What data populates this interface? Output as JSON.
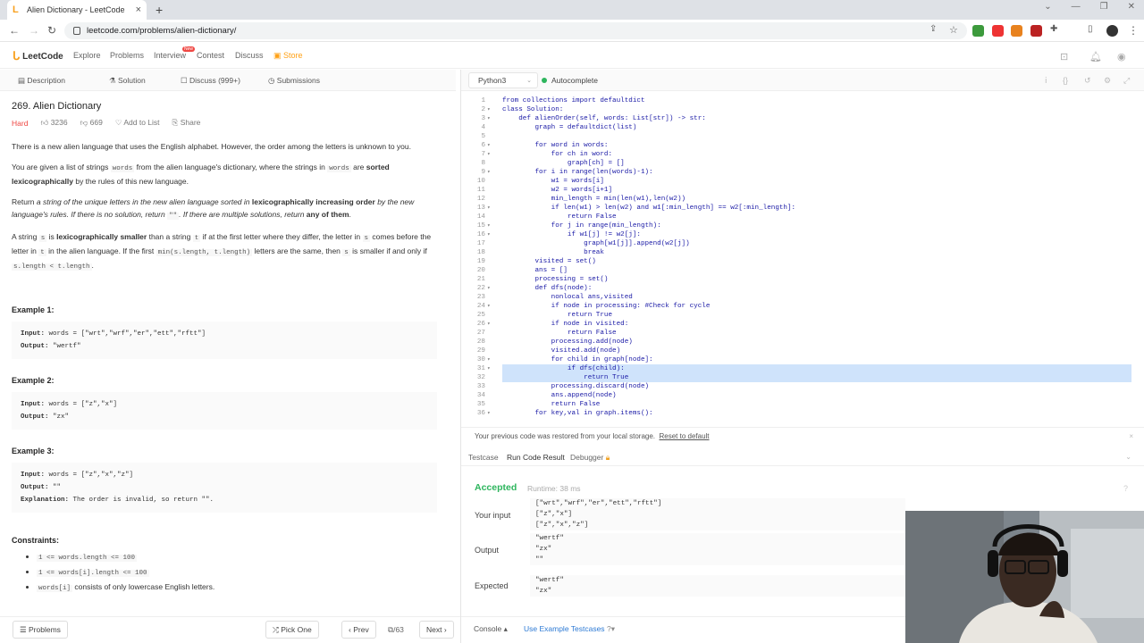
{
  "browser": {
    "tab_title": "Alien Dictionary - LeetCode",
    "url": "leetcode.com/problems/alien-dictionary/"
  },
  "header": {
    "logo_text": "LeetCode",
    "nav": [
      "Explore",
      "Problems",
      "Interview",
      "Contest",
      "Discuss",
      "Store"
    ],
    "new_badge": "New"
  },
  "left_tabs": [
    "Description",
    "Solution",
    "Discuss (999+)",
    "Submissions"
  ],
  "problem": {
    "title": "269. Alien Dictionary",
    "difficulty": "Hard",
    "likes": "3236",
    "dislikes": "669",
    "add_to_list": "Add to List",
    "share": "Share",
    "p1": "There is a new alien language that uses the English alphabet. However, the order among the letters is unknown to you.",
    "p2a": "You are given a list of strings ",
    "p2_code1": "words",
    "p2b": " from the alien language's dictionary, where the strings in ",
    "p2_code2": "words",
    "p2c": " are ",
    "p2_bold": "sorted lexicographically",
    "p2d": " by the rules of this new language.",
    "p3a": "Return ",
    "p3_i1": "a string of the unique letters in the new alien language sorted in ",
    "p3_bold": "lexicographically increasing order",
    "p3_i2": " by the new language's rules. If there is no solution, return ",
    "p3_code": "\"\"",
    "p3_i3": ". If there are multiple solutions, return ",
    "p3_bold2": "any of them",
    "p3_end": ".",
    "p4a": "A string ",
    "p4_s": "s",
    "p4b": " is ",
    "p4_bold": "lexicographically smaller",
    "p4c": " than a string ",
    "p4_t": "t",
    "p4d": " if at the first letter where they differ, the letter in ",
    "p4_s2": "s",
    "p4e": " comes before the letter in ",
    "p4_t2": "t",
    "p4f": " in the alien language. If the first ",
    "p4_code_min": "min(s.length, t.length)",
    "p4g": " letters are the same, then ",
    "p4_s3": "s",
    "p4h": " is smaller if and only if ",
    "p4_code_len": "s.length < t.length",
    "p4i": ".",
    "examples": [
      {
        "heading": "Example 1:",
        "input_label": "Input:",
        "input": "words = [\"wrt\",\"wrf\",\"er\",\"ett\",\"rftt\"]",
        "output_label": "Output:",
        "output": "\"wertf\""
      },
      {
        "heading": "Example 2:",
        "input_label": "Input:",
        "input": "words = [\"z\",\"x\"]",
        "output_label": "Output:",
        "output": "\"zx\""
      },
      {
        "heading": "Example 3:",
        "input_label": "Input:",
        "input": "words = [\"z\",\"x\",\"z\"]",
        "output_label": "Output:",
        "output": "\"\"",
        "explanation_label": "Explanation:",
        "explanation": "The order is invalid, so return \"\"."
      }
    ],
    "constraints_heading": "Constraints:",
    "constraints": [
      "1 <= words.length <= 100",
      "1 <= words[i].length <= 100"
    ],
    "constraint3_code": "words[i]",
    "constraint3_text": " consists of only lowercase English letters."
  },
  "left_footer": {
    "problems": "Problems",
    "pick_one": "Pick One",
    "prev": "Prev",
    "page": "/63",
    "next": "Next"
  },
  "editor_toolbar": {
    "language": "Python3",
    "autocomplete": "Autocomplete"
  },
  "code_lines": [
    "from collections import defaultdict",
    "class Solution:",
    "    def alienOrder(self, words: List[str]) -> str:",
    "        graph = defaultdict(list)",
    "",
    "        for word in words:",
    "            for ch in word:",
    "                graph[ch] = []",
    "        for i in range(len(words)-1):",
    "            w1 = words[i]",
    "            w2 = words[i+1]",
    "            min_length = min(len(w1),len(w2))",
    "            if len(w1) > len(w2) and w1[:min_length] == w2[:min_length]:",
    "                return False",
    "            for j in range(min_length):",
    "                if w1[j] != w2[j]:",
    "                    graph[w1[j]].append(w2[j])",
    "                    break",
    "        visited = set()",
    "        ans = []",
    "        processing = set()",
    "        def dfs(node):",
    "            nonlocal ans,visited",
    "            if node in processing: #Check for cycle",
    "                return True",
    "            if node in visited:",
    "                return False",
    "            processing.add(node)",
    "            visited.add(node)",
    "            for child in graph[node]:",
    "                if dfs(child):",
    "                    return True",
    "            processing.discard(node)",
    "            ans.append(node)",
    "            return False",
    "        for key,val in graph.items():"
  ],
  "console": {
    "restored_msg": "Your previous code was restored from your local storage.",
    "reset_link": "Reset to default",
    "tabs": [
      "Testcase",
      "Run Code Result",
      "Debugger"
    ],
    "status": "Accepted",
    "runtime": "Runtime: 38 ms",
    "your_input_label": "Your input",
    "your_input": [
      "[\"wrt\",\"wrf\",\"er\",\"ett\",\"rftt\"]",
      "[\"z\",\"x\"]",
      "[\"z\",\"x\",\"z\"]"
    ],
    "output_label": "Output",
    "output": [
      "\"wertf\"",
      "\"zx\"",
      "\"\""
    ],
    "expected_label": "Expected",
    "expected": [
      "\"wertf\"",
      "\"zx\""
    ]
  },
  "right_footer": {
    "console": "Console",
    "use_example": "Use Example Testcases"
  },
  "colors": {
    "accent": "#ffa116",
    "accepted": "#2db55d",
    "hard": "#ef4743"
  }
}
